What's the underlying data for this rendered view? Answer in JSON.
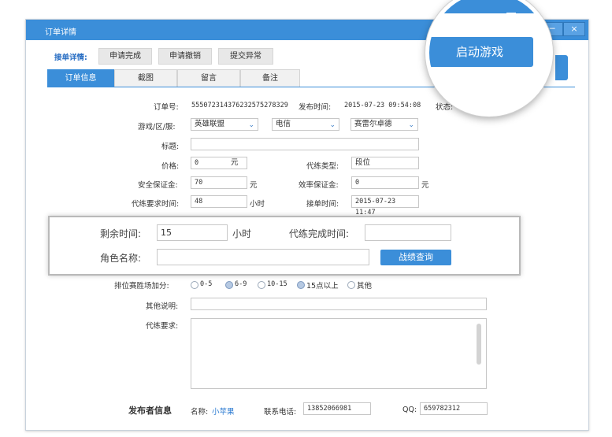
{
  "window": {
    "title": "订单详情",
    "close_icon": "×",
    "minimize_icon": "─"
  },
  "toolbar": {
    "label": "接单详情:",
    "buttons": [
      "申请完成",
      "申请撤销",
      "提交异常"
    ]
  },
  "launch_button": "启动游戏",
  "tabs": [
    "订单信息",
    "截图",
    "留言",
    "备注"
  ],
  "order": {
    "order_no_label": "订单号:",
    "order_no": "555072314376232575278329",
    "publish_time_label": "发布时间:",
    "publish_time": "2015-07-23 09:54:08",
    "status_label": "状态:",
    "server_label": "游戏/区/服:",
    "game": "英雄联盟",
    "region": "电信",
    "server": "赛雷尔卓德",
    "title_label": "标题:",
    "title_value": "",
    "price_label": "价格:",
    "price": "0",
    "unit_yuan": "元",
    "type_label": "代练类型:",
    "type_value": "段位",
    "deposit_label": "安全保证金:",
    "deposit": "70",
    "eff_label": "效率保证金:",
    "eff": "0",
    "req_time_label": "代练要求时间:",
    "req_time": "48",
    "unit_hour": "小时",
    "accept_time_label": "接单时间:",
    "accept_time": "2015-07-23 11:47"
  },
  "highlight": {
    "remain_label": "剩余时间:",
    "remain_value": "15",
    "remain_unit": "小时",
    "finish_label": "代练完成时间:",
    "finish_value": "",
    "role_label": "角色名称:",
    "role_value": "",
    "query_button": "战绩查询"
  },
  "extra": {
    "bonus_label": "排位赛胜场加分:",
    "options": [
      {
        "label": "0-5",
        "selected": false
      },
      {
        "label": "6-9",
        "selected": true
      },
      {
        "label": "10-15",
        "selected": false
      },
      {
        "label": "15点以上",
        "selected": true
      },
      {
        "label": "其他",
        "selected": false
      }
    ],
    "note_label": "其他说明:",
    "note_value": "",
    "req_label": "代练要求:",
    "req_value": ""
  },
  "publisher": {
    "heading": "发布者信息",
    "name_label": "名称:",
    "name": "小苹果",
    "phone_label": "联系电话:",
    "phone": "13852066981",
    "qq_label": "QQ:",
    "qq": "659782312"
  },
  "colors": {
    "accent": "#3b8ed9",
    "link": "#2a7ad1"
  }
}
